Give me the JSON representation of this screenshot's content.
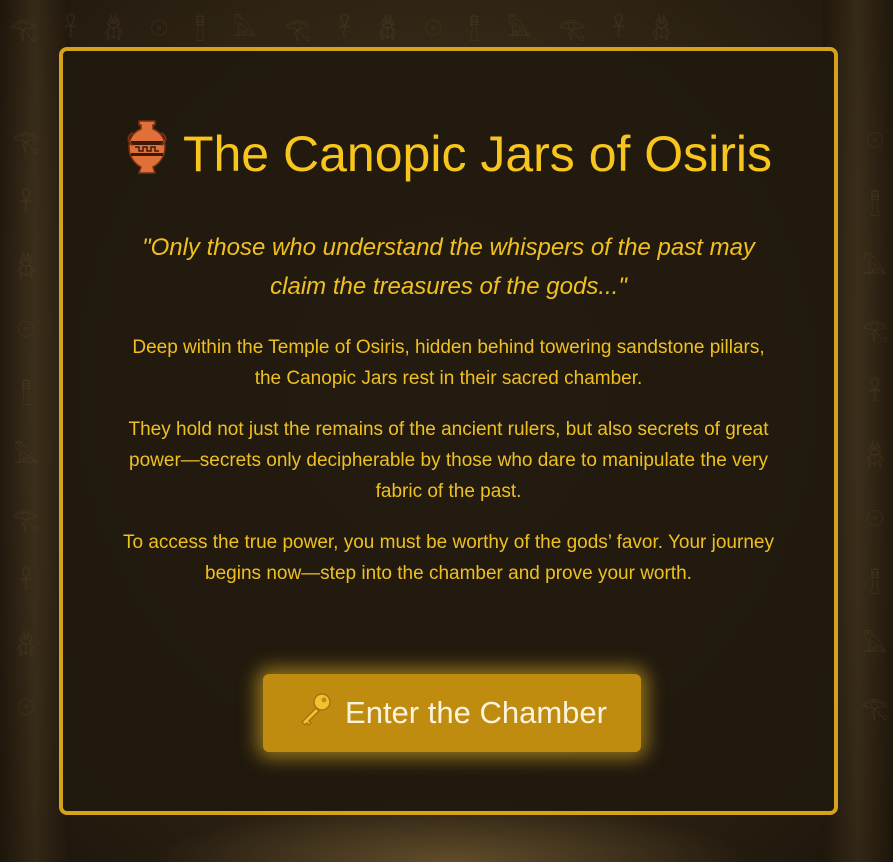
{
  "title": "The Canopic Jars of Osiris",
  "icons": {
    "title_icon": "amphora-icon",
    "button_icon": "key-icon"
  },
  "quote": "\"Only those who understand the whispers of the past may claim the treasures of the gods...\"",
  "paragraphs": [
    "Deep within the Temple of Osiris, hidden behind towering sandstone pillars, the Canopic Jars rest in their sacred chamber.",
    "They hold not just the remains of the ancient rulers, but also secrets of great power—secrets only decipherable by those who dare to manipulate the very fabric of the past.",
    "To access the true power, you must be worthy of the gods’ favor. Your journey begins now—step into the chamber and prove your worth."
  ],
  "button": {
    "label": "Enter the Chamber"
  },
  "colors": {
    "accent": "#f7c51c",
    "border": "#d6a21c",
    "button_bg": "#c08c10",
    "panel_bg": "#21190e"
  }
}
